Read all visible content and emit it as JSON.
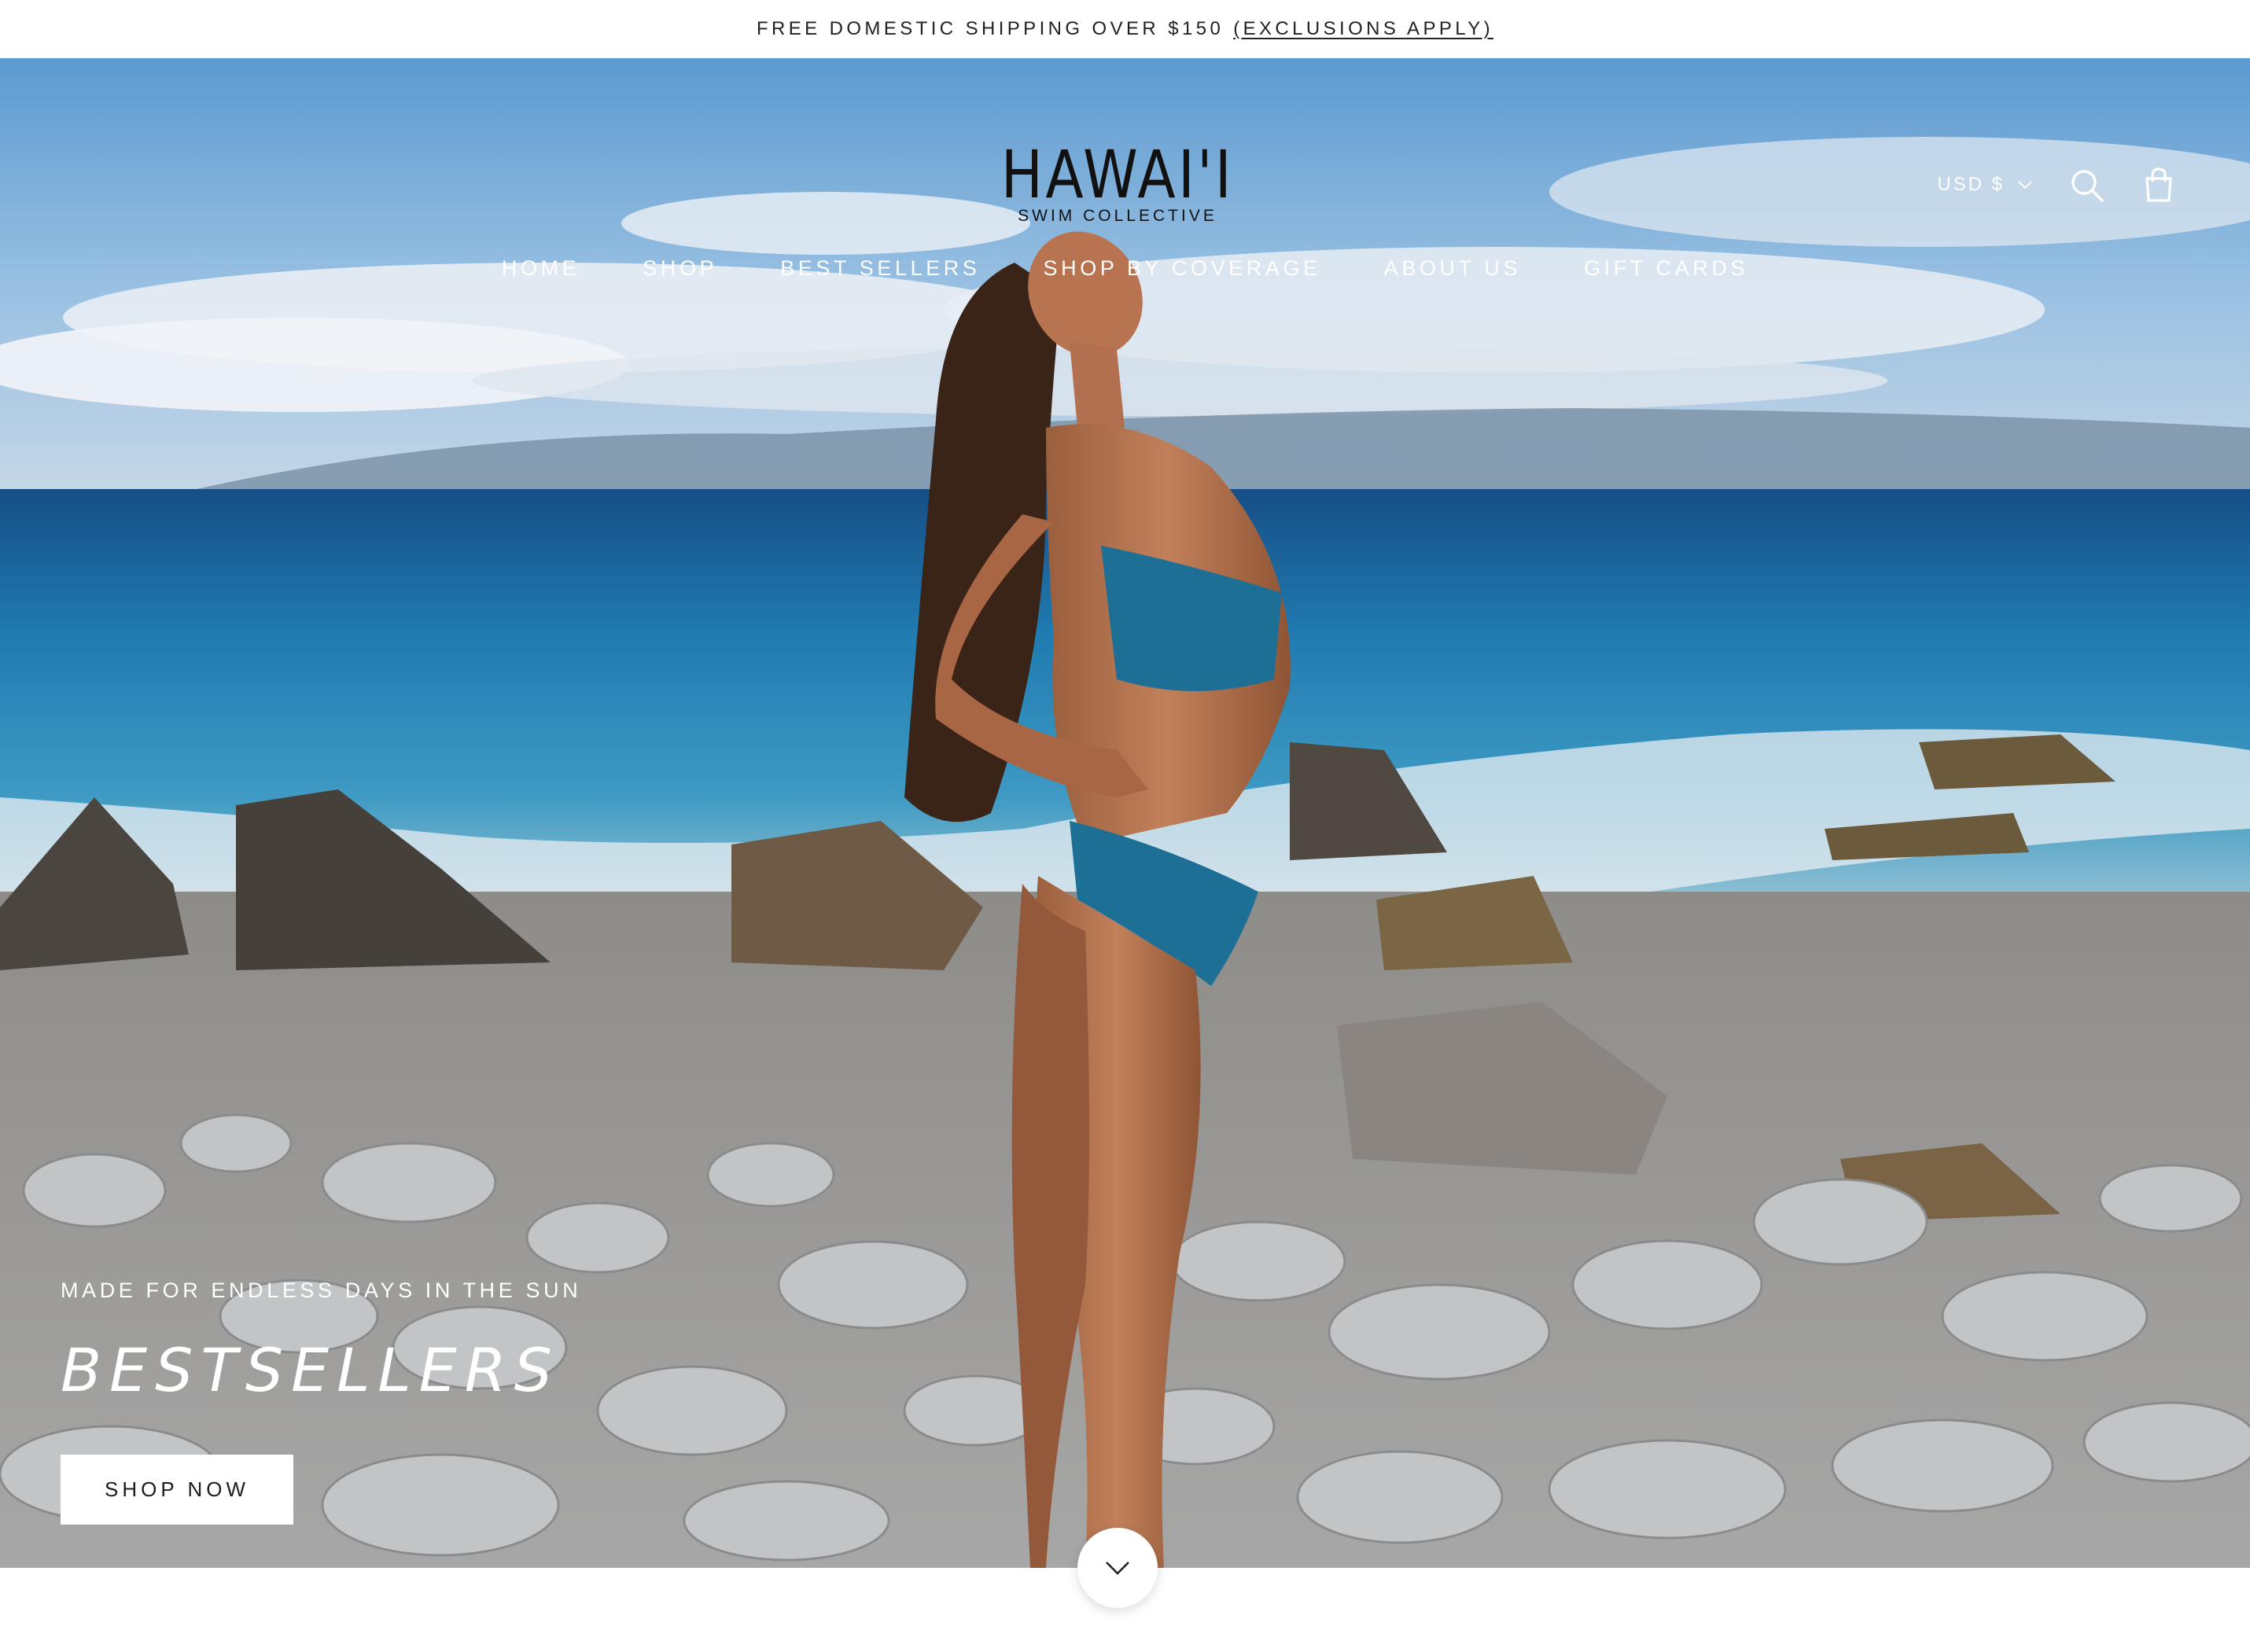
{
  "announcement": {
    "text": "FREE DOMESTIC SHIPPING OVER $150",
    "link": "(EXCLUSIONS APPLY)"
  },
  "header": {
    "logo_word": "HAWAI'I",
    "logo_sub": "SWIM COLLECTIVE",
    "currency": "USD $",
    "icons": [
      "chevron-down-icon",
      "search-icon",
      "shopping-bag-icon"
    ]
  },
  "nav": {
    "items": [
      "HOME",
      "SHOP",
      "BEST SELLERS",
      "SHOP BY COVERAGE",
      "ABOUT US",
      "GIFT CARDS"
    ]
  },
  "hero": {
    "kicker": "MADE FOR ENDLESS DAYS IN THE SUN",
    "headline": "BESTSELLERS",
    "cta": "SHOP NOW",
    "scroll_icon": "chevron-down-icon"
  },
  "colors": {
    "text_dark": "#1c1c1c",
    "announcement_bg": "#ffffff",
    "overlay_text": "#ffffff",
    "button_bg": "#ffffff",
    "swimsuit": "#1d6f95",
    "sea": "#1f7bb0"
  }
}
